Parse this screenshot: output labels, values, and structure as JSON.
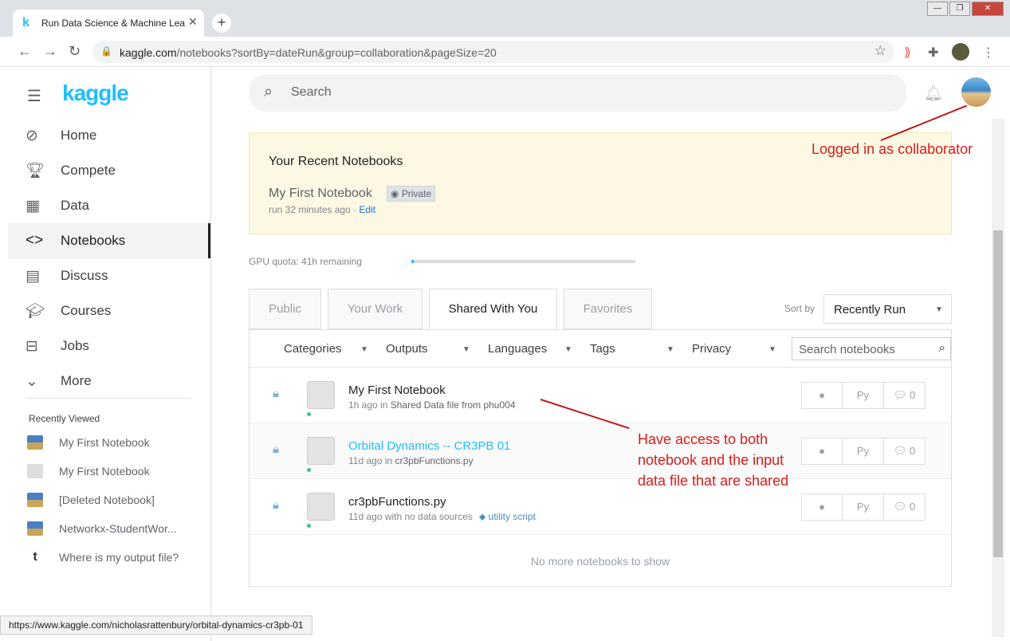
{
  "browser": {
    "tab_title": "Run Data Science & Machine Lea",
    "url_host": "kaggle.com",
    "url_path": "/notebooks?sortBy=dateRun&group=collaboration&pageSize=20",
    "status_url": "https://www.kaggle.com/nicholasrattenbury/orbital-dynamics-cr3pb-01"
  },
  "sidebar": {
    "logo": "kaggle",
    "nav": [
      {
        "label": "Home",
        "icon": "compass-icon"
      },
      {
        "label": "Compete",
        "icon": "trophy-icon"
      },
      {
        "label": "Data",
        "icon": "table-icon"
      },
      {
        "label": "Notebooks",
        "icon": "code-icon",
        "active": true
      },
      {
        "label": "Discuss",
        "icon": "comment-icon"
      },
      {
        "label": "Courses",
        "icon": "school-icon"
      },
      {
        "label": "Jobs",
        "icon": "briefcase-icon"
      },
      {
        "label": "More",
        "icon": "chevron-down-icon"
      }
    ],
    "recently_viewed_title": "Recently Viewed",
    "recent": [
      {
        "label": "My First Notebook"
      },
      {
        "label": "My First Notebook"
      },
      {
        "label": "[Deleted Notebook]"
      },
      {
        "label": "Networkx-StudentWor..."
      },
      {
        "label": "Where is my output file?"
      }
    ]
  },
  "header": {
    "search_placeholder": "Search"
  },
  "recent_notebooks": {
    "title": "Your Recent Notebooks",
    "notebook": "My First Notebook",
    "badge": "Private",
    "meta": "run 32 minutes ago · ",
    "edit": "Edit"
  },
  "gpu": {
    "label": "GPU quota: 41h remaining",
    "fraction_used": 0.01
  },
  "tabs": [
    {
      "label": "Public"
    },
    {
      "label": "Your Work"
    },
    {
      "label": "Shared With You",
      "active": true
    },
    {
      "label": "Favorites"
    }
  ],
  "sort": {
    "label": "Sort by",
    "value": "Recently Run"
  },
  "filters": {
    "categories": "Categories",
    "outputs": "Outputs",
    "languages": "Languages",
    "tags": "Tags",
    "privacy": "Privacy",
    "search_placeholder": "Search notebooks"
  },
  "notebooks": [
    {
      "title": "My First Notebook",
      "meta": "1h ago in",
      "source": "Shared Data file from phu004",
      "tag": "",
      "lang": "Py",
      "comments": "0"
    },
    {
      "title": "Orbital Dynamics -- CR3PB 01",
      "meta": "11d ago in",
      "source": "cr3pbFunctions.py",
      "tag": "",
      "lang": "Py",
      "comments": "0"
    },
    {
      "title": "cr3pbFunctions.py",
      "meta": "11d ago with no data sources",
      "source": "",
      "tag": "utility script",
      "lang": "Py",
      "comments": "0"
    }
  ],
  "no_more": "No more notebooks to show",
  "annotations": {
    "collaborator": "Logged in as collaborator",
    "access_line1": "Have access to both",
    "access_line2": "notebook and the input",
    "access_line3": "data file that are shared"
  },
  "colors": {
    "kaggle_blue": "#20beff",
    "annotation_red": "#d6201c",
    "recent_bg": "#fdf8e3"
  }
}
